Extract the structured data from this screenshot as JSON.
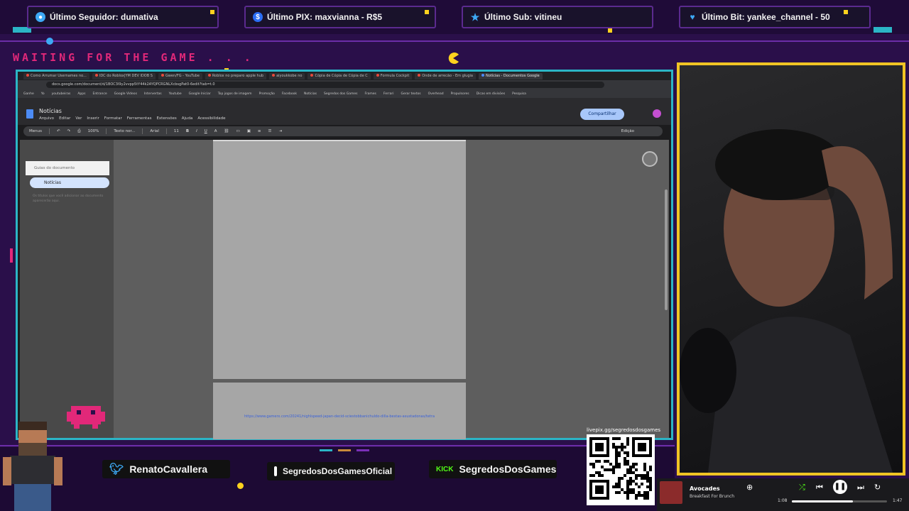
{
  "alerts": [
    {
      "label": "Último Seguidor: dumativa",
      "icon": "user-icon",
      "color": "#3da9f5"
    },
    {
      "label": "Último PIX: maxvianna - R$5",
      "icon": "dollar-icon",
      "color": "#2b6df5"
    },
    {
      "label": "Último Sub: vitineu",
      "icon": "star-icon",
      "color": "#3da9f5"
    },
    {
      "label": "Último Bit: yankee_channel - 50",
      "icon": "diamond-icon",
      "color": "#3da9f5"
    }
  ],
  "overlay": {
    "waiting_text": "WAITING FOR THE GAME . . ."
  },
  "browser": {
    "tabs": [
      "Como Arrumar Usernames no...",
      "IDC do Roblox|YM DEV IDOB S",
      "Gwen/FG - YouTube",
      "Roblox no preparo apple hub",
      "aiyoukkobe no",
      "Cópia de Cópia de Cópia de C",
      "Formula Cockpit",
      "Onde de arrecão - Em glugia",
      "Notícias - Documentos Google"
    ],
    "url": "docs.google.com/document/d/1BOC3I9y2vvpp5tY44k2AYQPCRGNLXcbsgPat0-6edit?tab=t.0",
    "bookmarks": [
      "Ganhe",
      "Yo",
      "youtubeiras",
      "Apps",
      "Entrance",
      "Google Videos",
      "Intervertas",
      "Youtube",
      "Google Iniciar",
      "Top jogos de imagem",
      "Promoção",
      "Facebook",
      "Notícias",
      "Segredos dos Games",
      "Frames",
      "Ferrari",
      "Gerar textos",
      "Overhead",
      "Propulsores",
      "Dicas em divisões",
      "Pesquisa"
    ]
  },
  "docs": {
    "title": "Notícias",
    "menus": [
      "Arquivo",
      "Editar",
      "Ver",
      "Inserir",
      "Formatar",
      "Ferramentas",
      "Extensões",
      "Ajuda",
      "Acessibilidade"
    ],
    "share_label": "Compartilhar",
    "toolbar": {
      "menus_label": "Menus",
      "zoom": "100%",
      "style": "Texto nor...",
      "font": "Arial",
      "size": "11",
      "editing_label": "Edição"
    },
    "outline": {
      "header": "Guias do documento",
      "item": "Notícias",
      "hint": "Os títulos que você adicionar ao documento aparecerão aqui."
    },
    "link_text": "https://www.gamerx.com/20241/nighlspeed-japan-decid-sciestobbanichuldo-dilla-bestas-asustadonas/tetra"
  },
  "socials": [
    {
      "name": "RenatoCavallera",
      "icon": "twitter-icon"
    },
    {
      "name": "SegredosDosGamesOficial",
      "icon": "instagram-icon"
    },
    {
      "name": "SegredosDosGames",
      "icon": "kick-icon",
      "badge": "KICK"
    }
  ],
  "qr": {
    "label": "livepix.gg/segredosdosgames"
  },
  "music": {
    "song": "Avocades",
    "artist": "Breakfast For Brunch",
    "elapsed": "1:08",
    "duration": "1:47",
    "progress": 0.64
  },
  "colors": {
    "accent_cyan": "#2bb5c6",
    "accent_yellow": "#f0c424",
    "accent_pink": "#e12879",
    "bg_purple": "#2a0f4a"
  }
}
